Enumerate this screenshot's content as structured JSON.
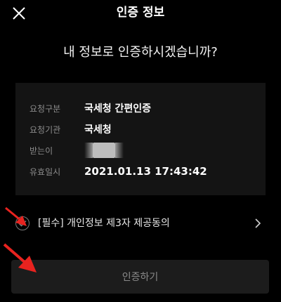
{
  "header": {
    "title": "인증 정보",
    "close_icon": "close-icon"
  },
  "prompt": {
    "question": "내 정보로 인증하시겠습니까?"
  },
  "info": {
    "rows": [
      {
        "label": "요청구분",
        "value": "국세청 간편인증"
      },
      {
        "label": "요청기관",
        "value": "국세청"
      },
      {
        "label": "받는이",
        "value": ""
      },
      {
        "label": "유효일시",
        "value": "2021.01.13 17:43:42"
      }
    ]
  },
  "consent": {
    "label": "[필수] 개인정보 제3자 제공동의",
    "checked": false,
    "icons": [
      "check-icon",
      "chevron-right-icon"
    ]
  },
  "action": {
    "label": "인증하기",
    "enabled": false
  },
  "annotations": {
    "arrow_color": "#e8231f"
  },
  "colors": {
    "background": "#000000",
    "card": "#141414",
    "button": "#1c1c1c"
  }
}
